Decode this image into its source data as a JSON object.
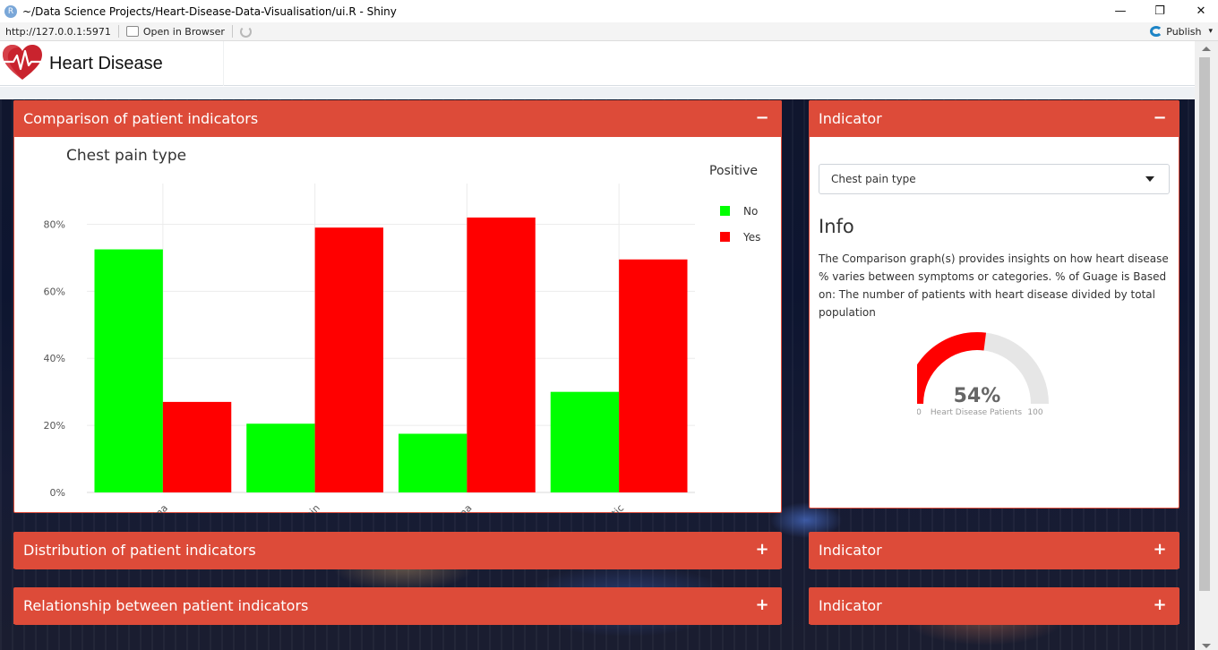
{
  "window": {
    "title": "~/Data Science Projects/Heart-Disease-Data-Visualisation/ui.R - Shiny",
    "app_icon_letter": "R",
    "controls": [
      "—",
      "❐",
      "✕"
    ]
  },
  "addressbar": {
    "url": "http://127.0.0.1:5971",
    "open_browser": "Open in Browser",
    "publish": "Publish"
  },
  "header": {
    "brand": "Heart Disease",
    "logo_icon": "heart-pulse-icon"
  },
  "boxes": {
    "comparison": {
      "title": "Comparison of patient indicators",
      "tool": "−"
    },
    "indicator_main": {
      "title": "Indicator",
      "tool": "−"
    },
    "distribution": {
      "title": "Distribution of patient indicators",
      "tool": "+"
    },
    "indicator_2": {
      "title": "Indicator",
      "tool": "+"
    },
    "relationship": {
      "title": "Relationship between patient indicators",
      "tool": "+"
    },
    "indicator_3": {
      "title": "Indicator",
      "tool": "+"
    }
  },
  "indicator": {
    "select_value": "Chest pain type",
    "info_title": "Info",
    "info_text": "The Comparison graph(s) provides insights on how heart disease % varies between symptoms or categories. % of Guage is Based on: The number of patients with heart disease divided by total population"
  },
  "gauge": {
    "value": 54,
    "label": "54%",
    "min_label": "0",
    "max_label": "100",
    "caption": "Heart Disease Patients",
    "fill_color": "#ff0000",
    "track_color": "#e6e6e6"
  },
  "chart_data": {
    "type": "bar",
    "title": "Chest pain type",
    "categories": [
      "Typical angina",
      "Non-anginal pain",
      "Atypical angina",
      "Asymptomatic"
    ],
    "series": [
      {
        "name": "No",
        "color": "#00ff00",
        "values": [
          72.5,
          20.5,
          17.5,
          30
        ]
      },
      {
        "name": "Yes",
        "color": "#ff0000",
        "values": [
          27,
          79,
          82,
          69.5
        ]
      }
    ],
    "legend_title": "Positive",
    "legend_position": "top-right",
    "yticks": [
      "0%",
      "20%",
      "40%",
      "60%",
      "80%"
    ],
    "ylim": [
      0,
      90
    ],
    "grid": true
  }
}
